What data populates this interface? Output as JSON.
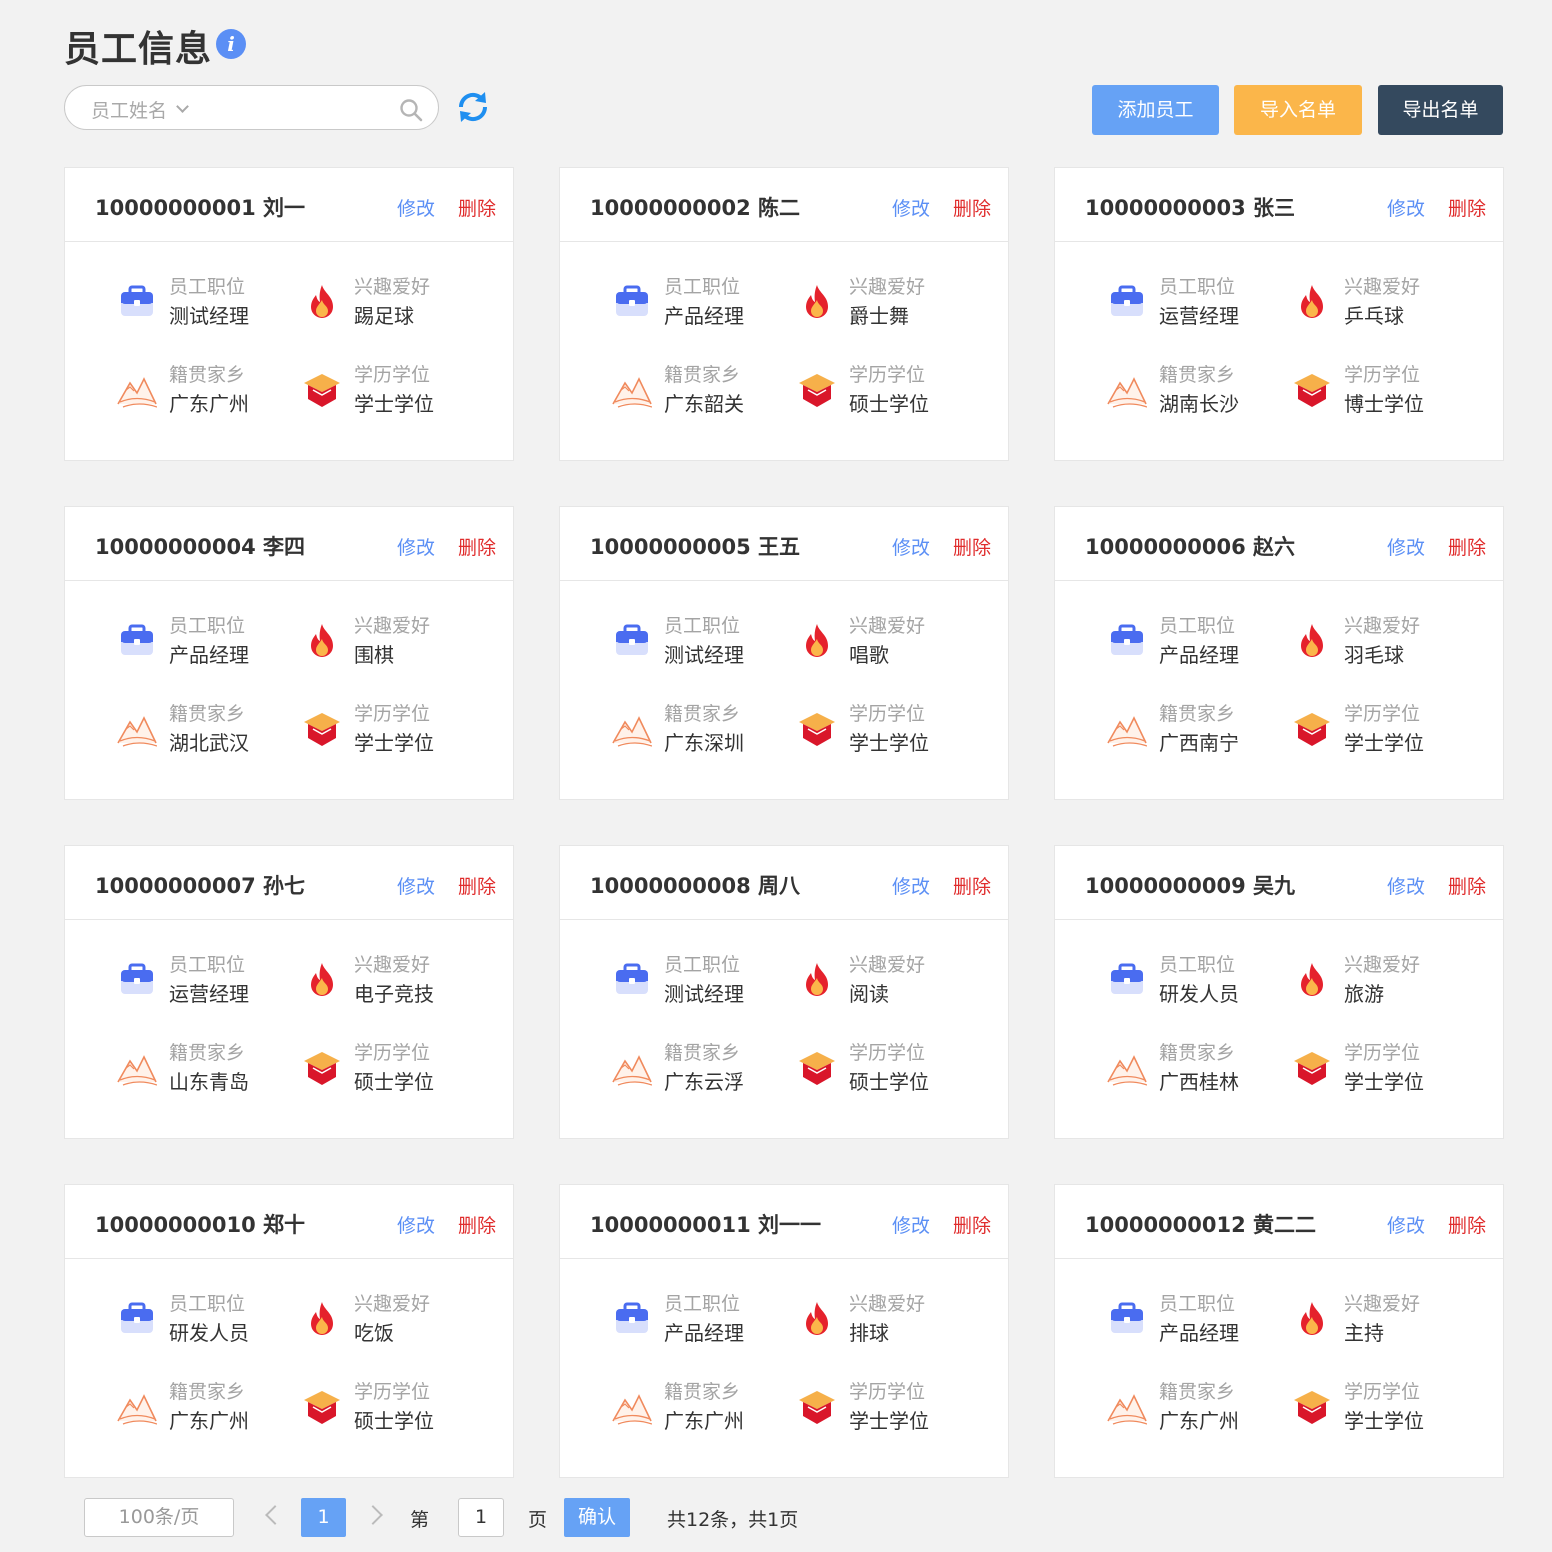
{
  "header": {
    "title": "员工信息",
    "info_icon": "info-icon",
    "info_glyph": "i"
  },
  "search": {
    "select_label": "员工姓名",
    "value": "",
    "icon": "search-icon"
  },
  "refresh_icon": "refresh-icon",
  "toolbar": {
    "add_label": "添加员工",
    "import_label": "导入名单",
    "export_label": "导出名单"
  },
  "card_labels": {
    "edit": "修改",
    "delete": "删除",
    "position": "员工职位",
    "hobby": "兴趣爱好",
    "hometown": "籍贯家乡",
    "degree": "学历学位"
  },
  "employees": [
    {
      "id": "10000000001",
      "name": "刘一",
      "position": "测试经理",
      "hobby": "踢足球",
      "hometown": "广东广州",
      "degree": "学士学位"
    },
    {
      "id": "10000000002",
      "name": "陈二",
      "position": "产品经理",
      "hobby": "爵士舞",
      "hometown": "广东韶关",
      "degree": "硕士学位"
    },
    {
      "id": "10000000003",
      "name": "张三",
      "position": "运营经理",
      "hobby": "乒乓球",
      "hometown": "湖南长沙",
      "degree": "博士学位"
    },
    {
      "id": "10000000004",
      "name": "李四",
      "position": "产品经理",
      "hobby": "围棋",
      "hometown": "湖北武汉",
      "degree": "学士学位"
    },
    {
      "id": "10000000005",
      "name": "王五",
      "position": "测试经理",
      "hobby": "唱歌",
      "hometown": "广东深圳",
      "degree": "学士学位"
    },
    {
      "id": "10000000006",
      "name": "赵六",
      "position": "产品经理",
      "hobby": "羽毛球",
      "hometown": "广西南宁",
      "degree": "学士学位"
    },
    {
      "id": "10000000007",
      "name": "孙七",
      "position": "运营经理",
      "hobby": "电子竞技",
      "hometown": "山东青岛",
      "degree": "硕士学位"
    },
    {
      "id": "10000000008",
      "name": "周八",
      "position": "测试经理",
      "hobby": "阅读",
      "hometown": "广东云浮",
      "degree": "硕士学位"
    },
    {
      "id": "10000000009",
      "name": "吴九",
      "position": "研发人员",
      "hobby": "旅游",
      "hometown": "广西桂林",
      "degree": "学士学位"
    },
    {
      "id": "10000000010",
      "name": "郑十",
      "position": "研发人员",
      "hobby": "吃饭",
      "hometown": "广东广州",
      "degree": "硕士学位"
    },
    {
      "id": "10000000011",
      "name": "刘一一",
      "position": "产品经理",
      "hobby": "排球",
      "hometown": "广东广州",
      "degree": "学士学位"
    },
    {
      "id": "10000000012",
      "name": "黄二二",
      "position": "产品经理",
      "hobby": "主持",
      "hometown": "广东广州",
      "degree": "学士学位"
    }
  ],
  "pagination": {
    "page_size": "100条/页",
    "current_page": "1",
    "goto_prefix": "第",
    "goto_value": "1",
    "goto_suffix": "页",
    "confirm_label": "确认",
    "summary": "共12条，共1页"
  },
  "colors": {
    "primary": "#66a2f5",
    "warning": "#fbb64a",
    "dark": "#34495e",
    "danger": "#e02d2d",
    "link": "#5b8ff5"
  }
}
